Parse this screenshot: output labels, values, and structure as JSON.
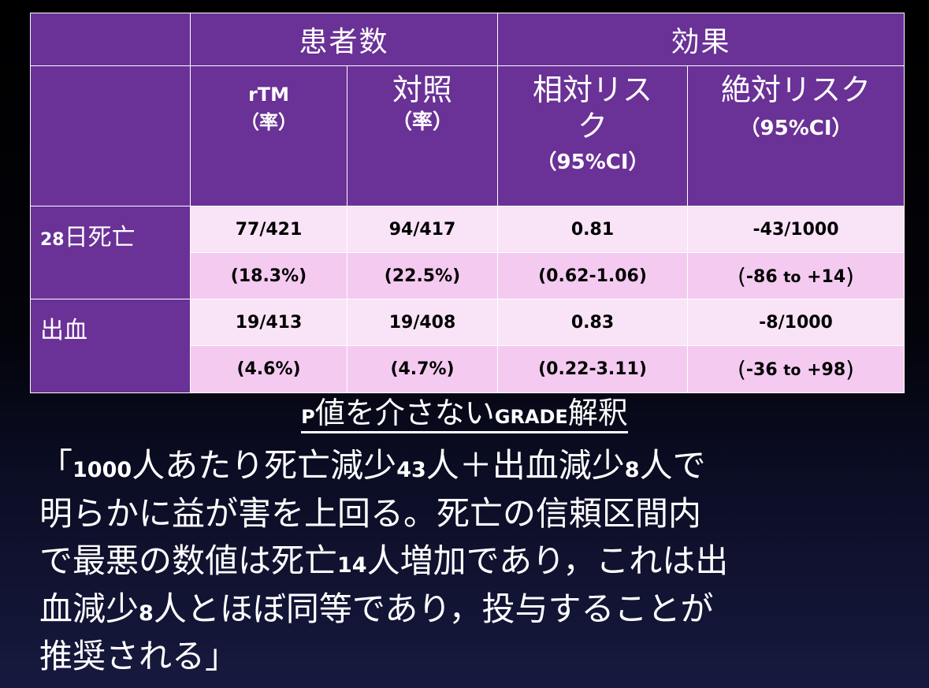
{
  "table": {
    "group_patients": "患者数",
    "group_effect": "効果",
    "col_rtm_top": "rTM",
    "col_rtm_bottom": "（率）",
    "col_control_top": "対照",
    "col_control_bottom": "（率）",
    "col_rr_line1": "相対リス",
    "col_rr_line2": "ク",
    "col_rr_ci": "（95%CI）",
    "col_ar_line1": "絶対リスク",
    "col_ar_ci": "（95%CI）",
    "rows": [
      {
        "label_num": "28",
        "label_text": "日死亡",
        "rtm": "77/421",
        "rtm_rate": "(18.3%)",
        "control": "94/417",
        "control_rate": "(22.5%)",
        "rr": "0.81",
        "rr_ci": "(0.62-1.06)",
        "ar": "-43/1000",
        "ar_ci_low": "-86",
        "ar_ci_to": "to",
        "ar_ci_high": "+14"
      },
      {
        "label_num": "",
        "label_text": "出血",
        "rtm": "19/413",
        "rtm_rate": "(4.6%)",
        "control": "19/408",
        "control_rate": "(4.7%)",
        "rr": "0.83",
        "rr_ci": "(0.22-3.11)",
        "ar": "-8/1000",
        "ar_ci_low": "-36",
        "ar_ci_to": "to",
        "ar_ci_high": "+98"
      }
    ]
  },
  "summary": {
    "title_p": "P",
    "title_mid": "値を介さない",
    "title_grade": "GRADE",
    "title_end": "解釈",
    "line1_a": "「",
    "line1_n1": "1000",
    "line1_b": "人あたり死亡減少",
    "line1_n2": "43",
    "line1_c": "人＋出血減少",
    "line1_n3": "8",
    "line1_d": "人で",
    "line2": "明らかに益が害を上回る。死亡の信頼区間内",
    "line3_a": "で最悪の数値は死亡",
    "line3_n": "14",
    "line3_b": "人増加であり，これは出",
    "line4_a": "血減少",
    "line4_n": "8",
    "line4_b": "人とほぼ同等であり，投与することが",
    "line5": "推奨される」"
  }
}
